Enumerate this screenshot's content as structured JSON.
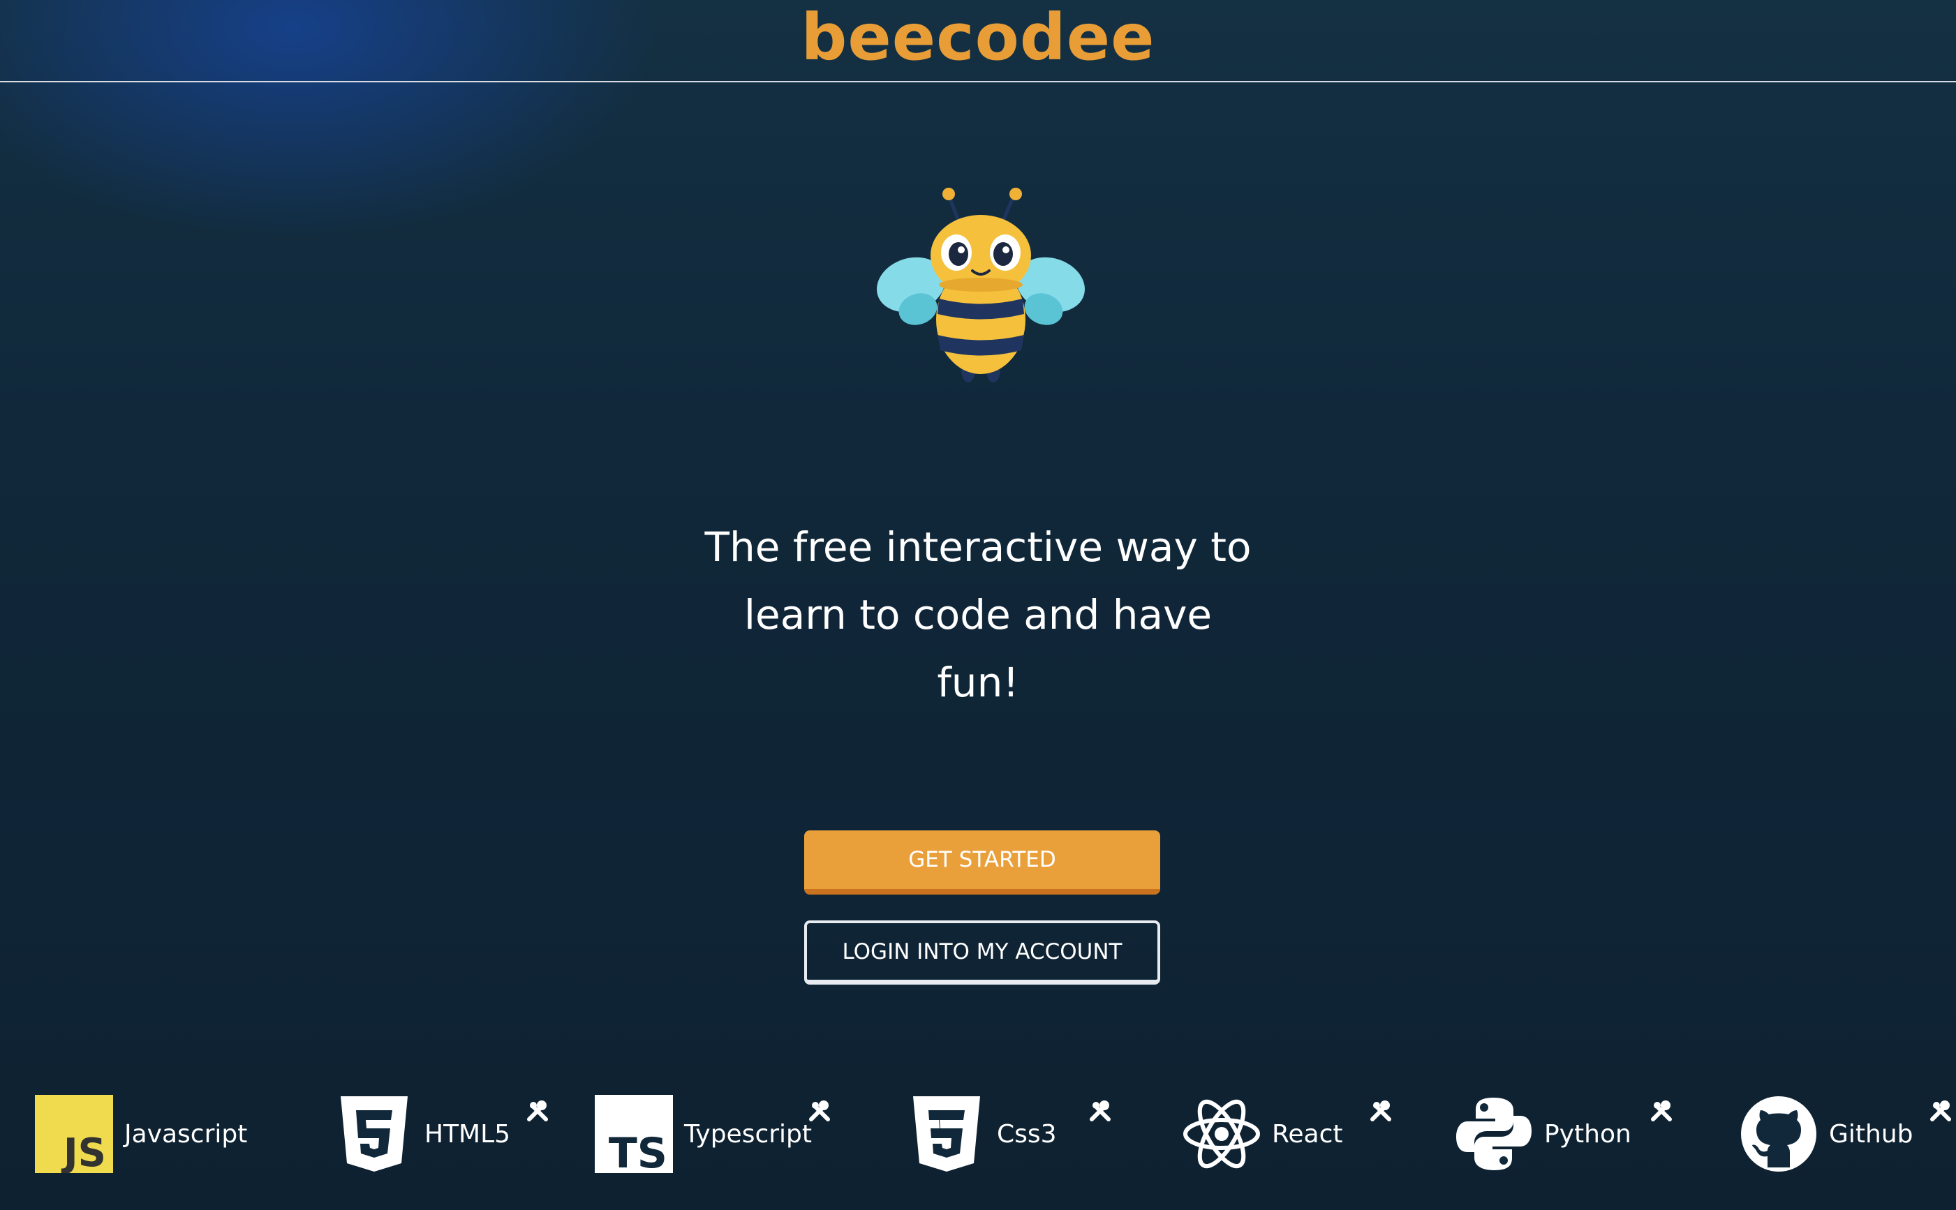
{
  "header": {
    "logo_text": "beecodee"
  },
  "hero": {
    "mascot_icon": "bee-mascot-icon",
    "tagline_lines": [
      "The free interactive way to",
      "learn to code and have",
      "fun!"
    ]
  },
  "actions": {
    "get_started_label": "GET STARTED",
    "login_label": "LOGIN INTO MY ACCOUNT"
  },
  "technologies": [
    {
      "label": "Javascript",
      "icon": "javascript-icon",
      "has_tools_icon": false
    },
    {
      "label": "HTML5",
      "icon": "html5-icon",
      "has_tools_icon": true
    },
    {
      "label": "Typescript",
      "icon": "typescript-icon",
      "has_tools_icon": true
    },
    {
      "label": "Css3",
      "icon": "css3-icon",
      "has_tools_icon": true
    },
    {
      "label": "React",
      "icon": "react-icon",
      "has_tools_icon": true
    },
    {
      "label": "Python",
      "icon": "python-icon",
      "has_tools_icon": true
    },
    {
      "label": "Github",
      "icon": "github-icon",
      "has_tools_icon": true
    }
  ],
  "colors": {
    "brand": "#e89d36",
    "button_primary": "#e9a03b",
    "background": "#10283a",
    "javascript_badge": "#f0db4f"
  }
}
